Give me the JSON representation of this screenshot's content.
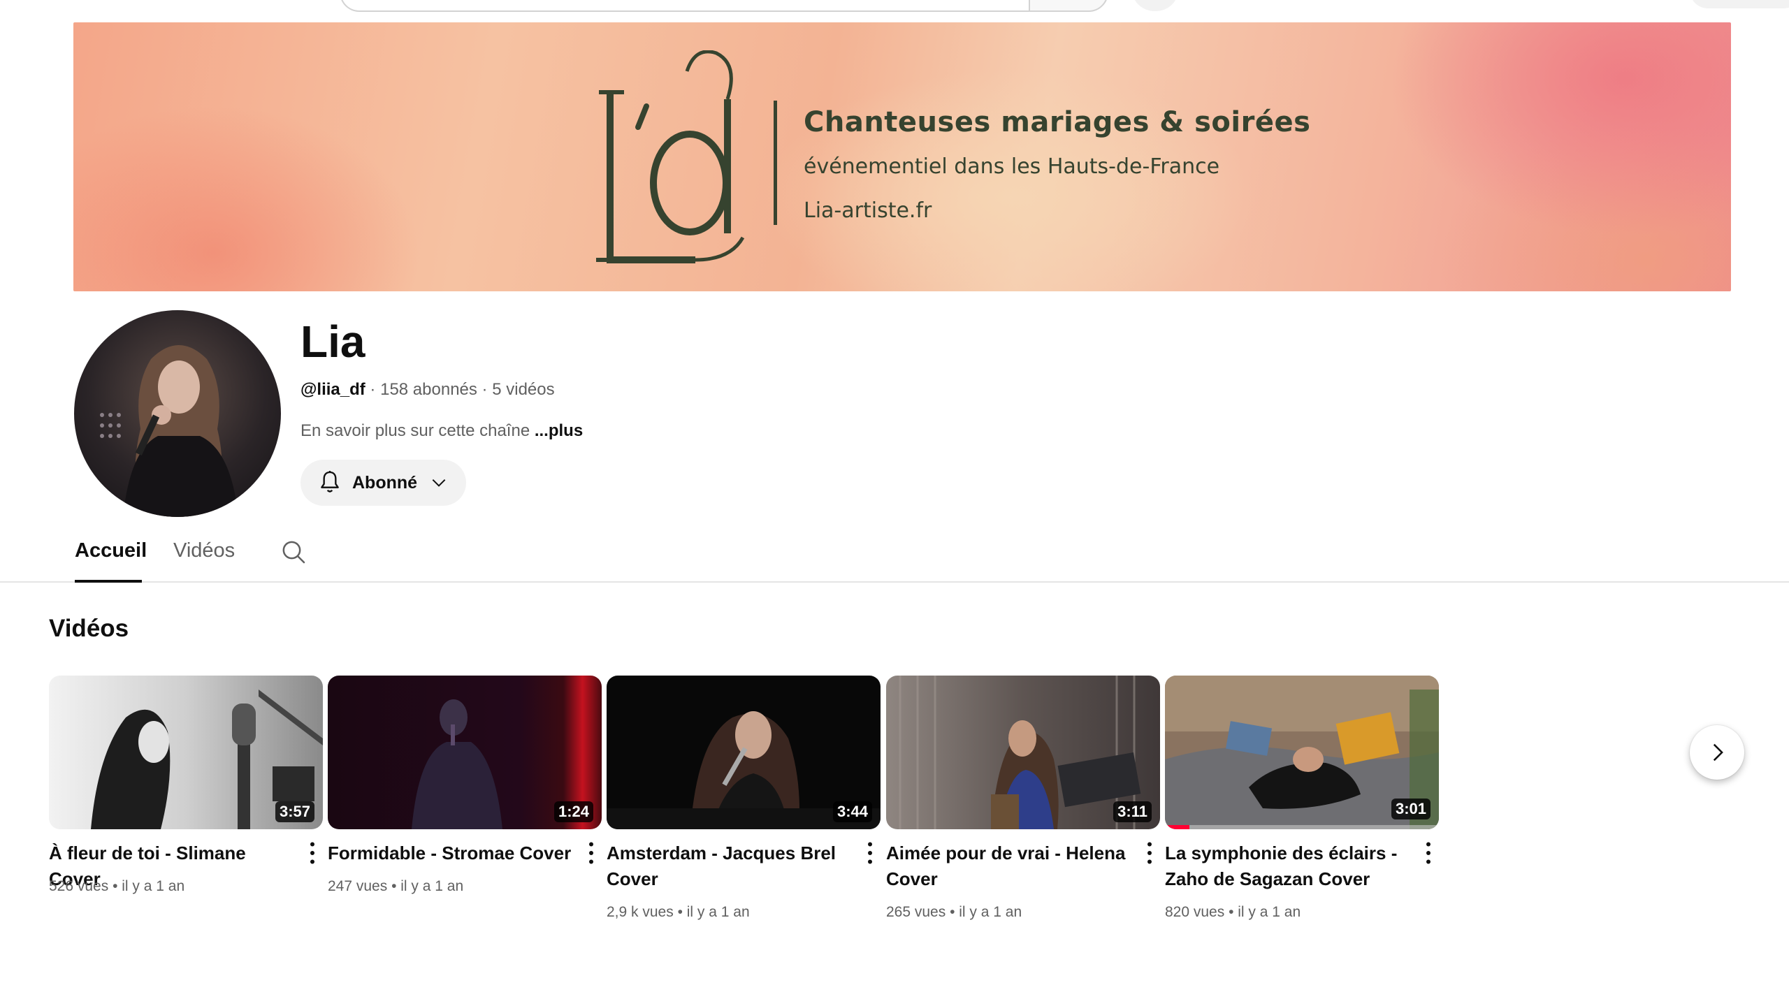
{
  "banner": {
    "logo_text": "L'a",
    "title": "Chanteuses mariages & soirées",
    "subtitle": "événementiel dans les Hauts-de-France",
    "url": "Lia-artiste.fr"
  },
  "channel": {
    "name": "Lia",
    "handle": "@liia_df",
    "subscribers": "158 abonnés",
    "video_count": "5 vidéos",
    "separator": " · ",
    "description": "En savoir plus sur cette chaîne",
    "more_label": "...plus",
    "subscribe_label": "Abonné"
  },
  "tabs": [
    {
      "label": "Accueil"
    },
    {
      "label": "Vidéos"
    }
  ],
  "section": {
    "title": "Vidéos"
  },
  "videos": [
    {
      "title": "À fleur de toi - Slimane Cover",
      "duration": "3:57",
      "views": "526 vues",
      "age": "il y a 1 an"
    },
    {
      "title": "Formidable - Stromae Cover",
      "duration": "1:24",
      "views": "247 vues",
      "age": "il y a 1 an"
    },
    {
      "title": "Amsterdam - Jacques Brel Cover",
      "duration": "3:44",
      "views": "2,9 k vues",
      "age": "il y a 1 an"
    },
    {
      "title": "Aimée pour de vrai - Helena Cover",
      "duration": "3:11",
      "views": "265 vues",
      "age": "il y a 1 an"
    },
    {
      "title": "La symphonie des éclairs - Zaho de Sagazan Cover",
      "duration": "3:01",
      "views": "820 vues",
      "age": "il y a 1 an",
      "watched_fraction": 0.09
    }
  ],
  "meta_separator": " • ",
  "icons": {
    "bell": "bell-icon",
    "chevron": "chevron-down-icon",
    "search": "search-icon",
    "kebab": "more-vert-icon",
    "next": "chevron-right-icon"
  },
  "colors": {
    "banner_text": "#36432f",
    "progress": "#ff0033"
  }
}
